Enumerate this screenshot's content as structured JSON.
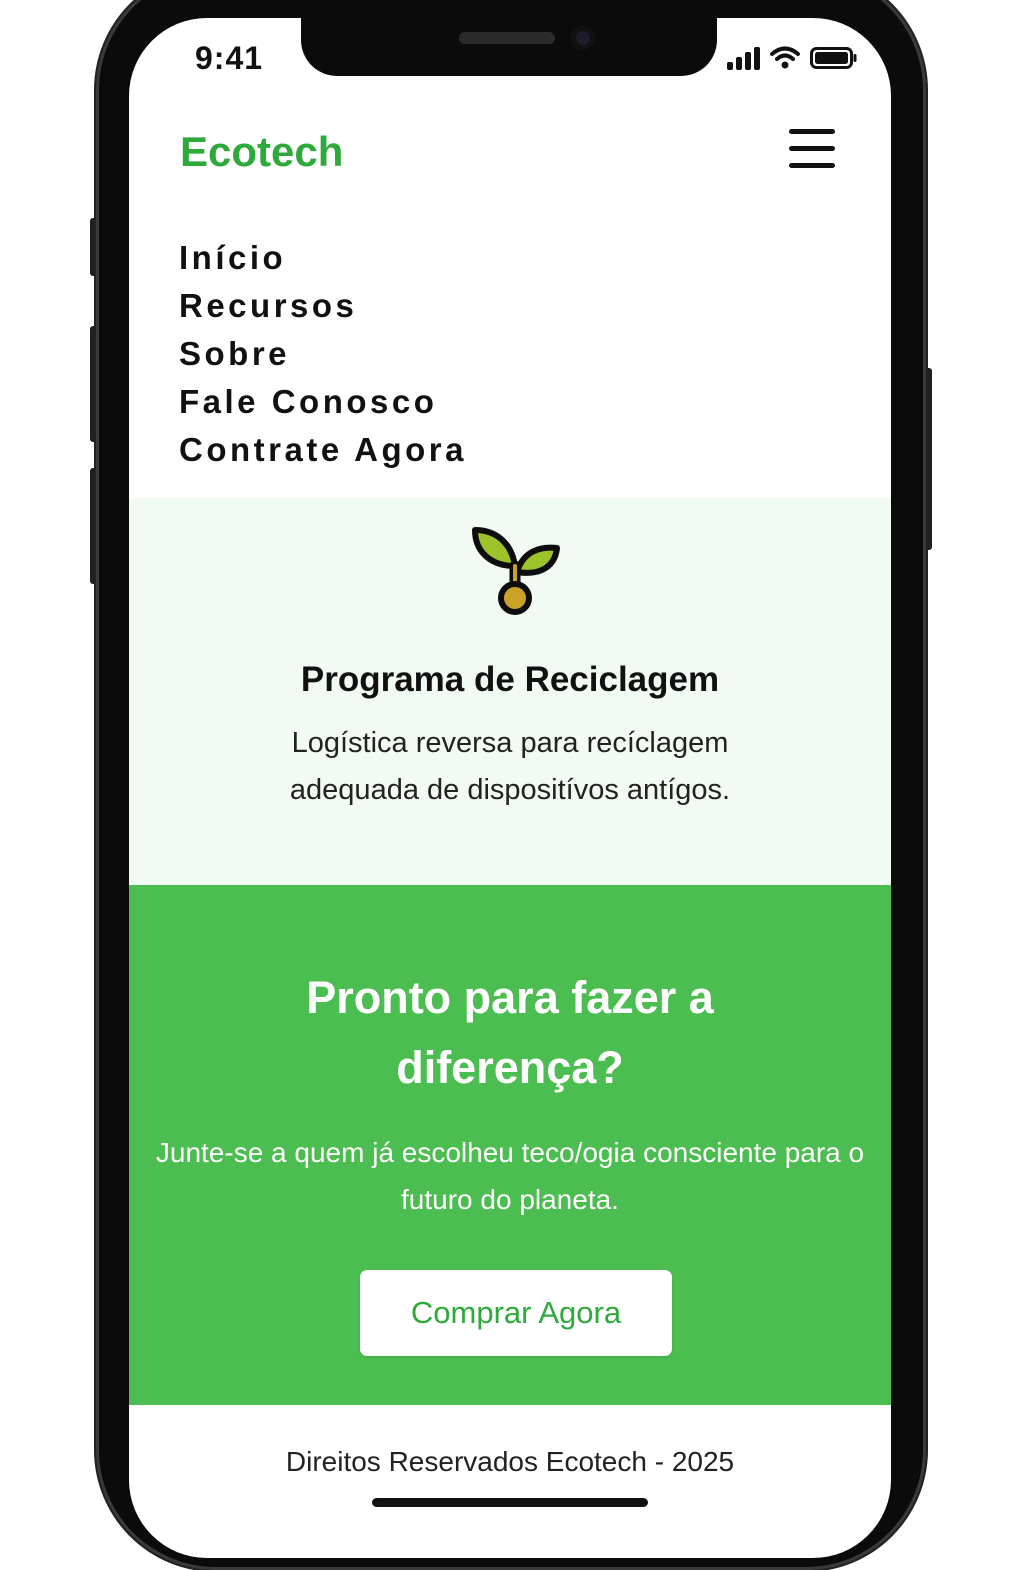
{
  "status_bar": {
    "time": "9:41"
  },
  "header": {
    "logo": "Ecotech"
  },
  "nav": {
    "items": [
      {
        "label": "Início"
      },
      {
        "label": "Recursos"
      },
      {
        "label": "Sobre"
      },
      {
        "label": "Fale Conosco"
      },
      {
        "label": "Contrate Agora"
      }
    ]
  },
  "feature": {
    "icon": "sprout-icon",
    "title": "Programa de Reciclagem",
    "description": "Logística reversa para recíclagem adequada de dispositívos antígos."
  },
  "cta": {
    "title": "Pronto para fazer a diferença?",
    "text": "Junte-se a quem já escolheu teco/ogia consciente para o futuro do planeta.",
    "button_label": "Comprar Agora"
  },
  "footer": {
    "text": "Direitos Reservados Ecotech - 2025"
  },
  "colors": {
    "brand_green": "#2eaa3b",
    "cta_background": "#4cbd50",
    "feature_background": "#f1fbf3"
  }
}
